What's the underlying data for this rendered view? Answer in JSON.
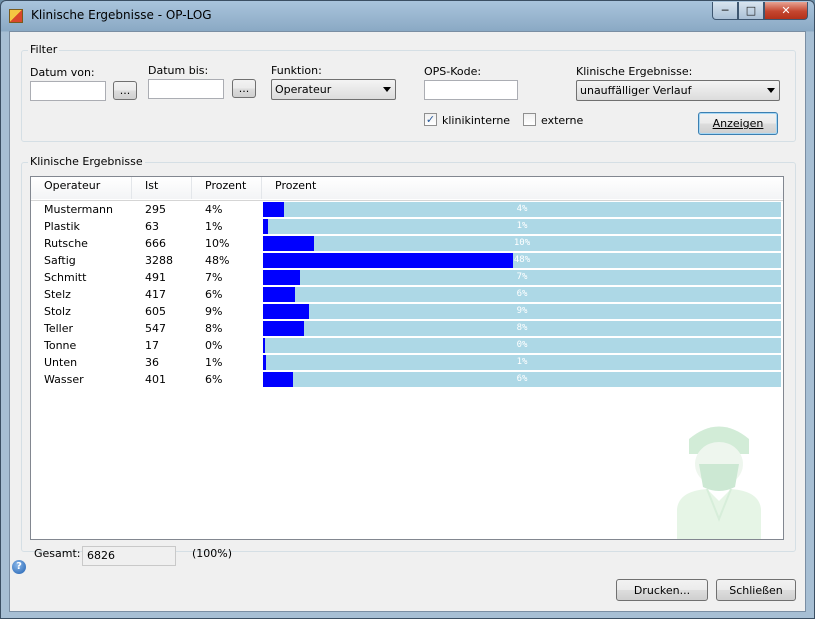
{
  "window": {
    "title": "Klinische Ergebnisse - OP-LOG"
  },
  "caption": {
    "minimize": "─",
    "maximize": "□",
    "close": "✕"
  },
  "filter": {
    "group_label": "Filter",
    "datum_von_label": "Datum von:",
    "datum_von_value": "",
    "datum_bis_label": "Datum bis:",
    "datum_bis_value": "",
    "browse_label": "...",
    "funktion_label": "Funktion:",
    "funktion_value": "Operateur",
    "ops_label": "OPS-Kode:",
    "ops_value": "",
    "ergebnisse_label": "Klinische Ergebnisse:",
    "ergebnisse_value": "unauffälliger Verlauf",
    "klinikinterne_label": "klinikinterne",
    "klinikinterne_checked": true,
    "externe_label": "externe",
    "externe_checked": false,
    "anzeigen_label": "Anzeigen"
  },
  "results": {
    "group_label": "Klinische Ergebnisse",
    "columns": [
      "Operateur",
      "Ist",
      "Prozent",
      "Prozent"
    ],
    "rows": [
      {
        "name": "Mustermann",
        "ist": "295",
        "prozent": "4%",
        "fraction": 0.04,
        "bar_text": "4%"
      },
      {
        "name": "Plastik",
        "ist": "63",
        "prozent": "1%",
        "fraction": 0.009,
        "bar_text": "1%"
      },
      {
        "name": "Rutsche",
        "ist": "666",
        "prozent": "10%",
        "fraction": 0.0976,
        "bar_text": "10%"
      },
      {
        "name": "Saftig",
        "ist": "3288",
        "prozent": "48%",
        "fraction": 0.4817,
        "bar_text": "48%"
      },
      {
        "name": "Schmitt",
        "ist": "491",
        "prozent": "7%",
        "fraction": 0.0719,
        "bar_text": "7%"
      },
      {
        "name": "Stelz",
        "ist": "417",
        "prozent": "6%",
        "fraction": 0.0611,
        "bar_text": "6%"
      },
      {
        "name": "Stolz",
        "ist": "605",
        "prozent": "9%",
        "fraction": 0.0886,
        "bar_text": "9%"
      },
      {
        "name": "Teller",
        "ist": "547",
        "prozent": "8%",
        "fraction": 0.0801,
        "bar_text": "8%"
      },
      {
        "name": "Tonne",
        "ist": "17",
        "prozent": "0%",
        "fraction": 0.0025,
        "bar_text": "0%"
      },
      {
        "name": "Unten",
        "ist": "36",
        "prozent": "1%",
        "fraction": 0.0053,
        "bar_text": "1%"
      },
      {
        "name": "Wasser",
        "ist": "401",
        "prozent": "6%",
        "fraction": 0.0587,
        "bar_text": "6%"
      }
    ]
  },
  "footer": {
    "gesamt_label": "Gesamt:",
    "gesamt_value": "6826",
    "gesamt_percent": "(100%)",
    "drucken_label": "Drucken...",
    "schliessen_label": "Schließen",
    "help_glyph": "?"
  },
  "colors": {
    "bar_fill": "#0000ff",
    "bar_background": "#add8e6"
  },
  "icons": [
    "app-icon",
    "help-icon",
    "surgeon-watermark"
  ]
}
